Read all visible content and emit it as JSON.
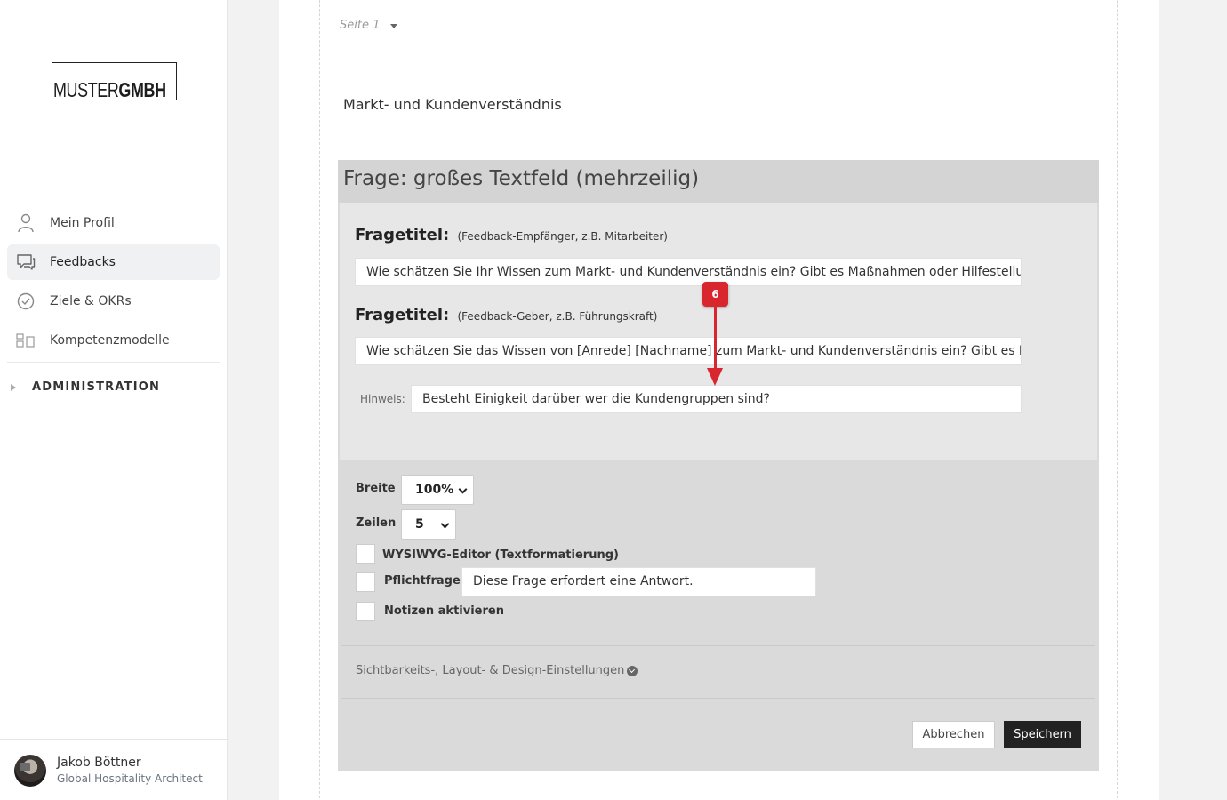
{
  "brand": {
    "logo_light": "MUSTER",
    "logo_bold": "GMBH"
  },
  "sidebar": {
    "items": [
      {
        "label": "Mein Profil",
        "icon": "user-icon"
      },
      {
        "label": "Feedbacks",
        "icon": "chat-icon",
        "active": true
      },
      {
        "label": "Ziele & OKRs",
        "icon": "check-circle-icon"
      },
      {
        "label": "Kompetenzmodelle",
        "icon": "blocks-icon"
      }
    ],
    "admin_label": "ADMINISTRATION"
  },
  "user": {
    "name": "Jakob Böttner",
    "role": "Global Hospitality Architect"
  },
  "page": {
    "seite": "Seite 1",
    "section_title": "Markt- und Kundenverständnis"
  },
  "question": {
    "header": "Frage: großes Textfeld (mehrzeilig)",
    "fragetitel_label": "Fragetitel:",
    "empfaenger_hint": "(Feedback-Empfänger, z.B. Mitarbeiter)",
    "empfaenger_value": "Wie schätzen Sie Ihr Wissen zum Markt- und Kundenverständnis ein? Gibt es Maßnahmen oder Hilfestellungen",
    "geber_hint": "(Feedback-Geber, z.B. Führungskraft)",
    "geber_value": "Wie schätzen Sie das Wissen von [Anrede] [Nachname] zum Markt- und Kundenverständnis ein? Gibt es Maßnahmen",
    "hinweis_label": "Hinweis:",
    "hinweis_value": "Besteht Einigkeit darüber wer die Kundengruppen sind?"
  },
  "options": {
    "breite_label": "Breite",
    "breite_value": "100%",
    "zeilen_label": "Zeilen",
    "zeilen_value": "5",
    "wysiwyg_label": "WYSIWYG-Editor (Textformatierung)",
    "pflicht_label": "Pflichtfrage",
    "pflicht_value": "Diese Frage erfordert eine Antwort.",
    "notizen_label": "Notizen aktivieren",
    "visibility_label": "Sichtbarkeits-, Layout- & Design-Einstellungen"
  },
  "buttons": {
    "cancel": "Abbrechen",
    "save": "Speichern"
  },
  "annotation": {
    "step": "6",
    "color": "#d9262e"
  }
}
